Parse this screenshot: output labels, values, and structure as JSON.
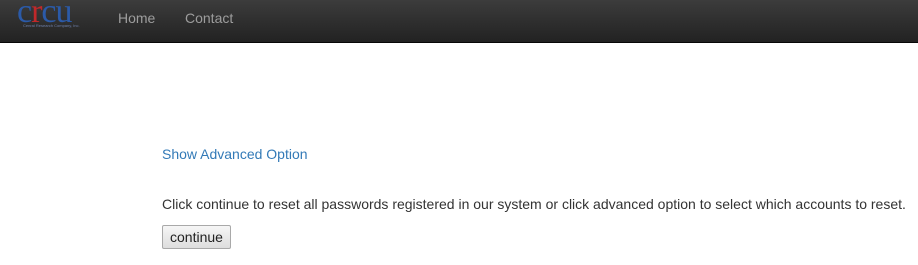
{
  "navbar": {
    "brand": {
      "logo_text_part1": "c",
      "logo_text_part2": "r",
      "logo_text_part3": "cu",
      "tagline": "Cenral Research Company, Inc."
    },
    "links": [
      {
        "label": "Home"
      },
      {
        "label": "Contact"
      }
    ]
  },
  "main": {
    "advanced_option_label": "Show Advanced Option",
    "instructions": "Click continue to reset all passwords registered in our system or click advanced option to select which accounts to reset.",
    "continue_label": "continue"
  },
  "colors": {
    "navbar_bg": "#222222",
    "nav_link": "#9d9d9d",
    "link": "#337ab7",
    "text": "#333333",
    "logo_blue": "#2b5aa8",
    "logo_red": "#c0282a"
  }
}
